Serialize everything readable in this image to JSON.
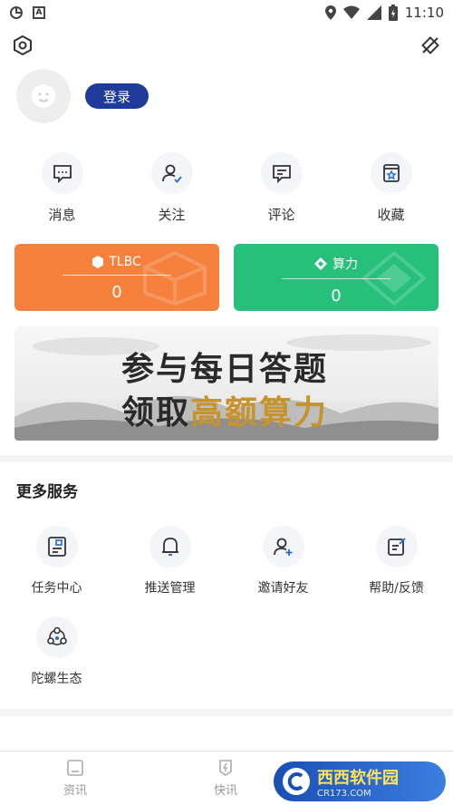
{
  "status_bar": {
    "time": "11:10"
  },
  "profile": {
    "login_label": "登录"
  },
  "quick_actions": [
    {
      "label": "消息",
      "icon": "message-icon"
    },
    {
      "label": "关注",
      "icon": "follow-icon"
    },
    {
      "label": "评论",
      "icon": "comment-icon"
    },
    {
      "label": "收藏",
      "icon": "favorite-icon"
    }
  ],
  "cards": {
    "tlbc": {
      "title": "TLBC",
      "value": "0",
      "color": "#f5813d"
    },
    "power": {
      "title": "算力",
      "value": "0",
      "color": "#27c07a"
    }
  },
  "banner": {
    "line1": "参与每日答题",
    "line2_plain": "领取",
    "line2_highlight": "高额算力"
  },
  "more_services": {
    "title": "更多服务",
    "items": [
      {
        "label": "任务中心",
        "icon": "task-icon"
      },
      {
        "label": "推送管理",
        "icon": "bell-icon"
      },
      {
        "label": "邀请好友",
        "icon": "invite-icon"
      },
      {
        "label": "帮助/反馈",
        "icon": "feedback-icon"
      },
      {
        "label": "陀螺生态",
        "icon": "ecosystem-icon"
      }
    ]
  },
  "tab_bar": [
    {
      "label": "资讯",
      "icon": "news-icon"
    },
    {
      "label": "快讯",
      "icon": "flash-icon"
    }
  ],
  "watermark": {
    "brand": "西西软件园",
    "domain": "CR173.COM"
  },
  "colors": {
    "accent": "#1e3a9a",
    "orange": "#f5813d",
    "green": "#27c07a"
  }
}
